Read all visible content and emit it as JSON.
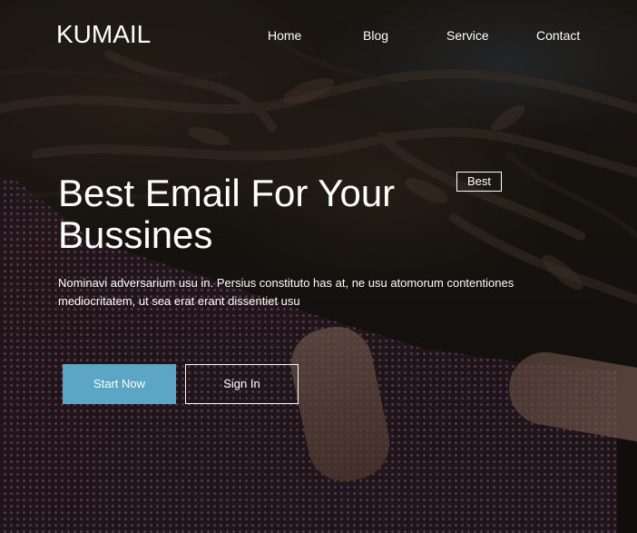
{
  "brand": {
    "logo_text": "KUMAIL"
  },
  "nav": {
    "items": [
      {
        "label": "Home"
      },
      {
        "label": "Blog"
      },
      {
        "label": "Service"
      },
      {
        "label": "Contact"
      }
    ]
  },
  "hero": {
    "badge": "Best",
    "headline": "Best Email For Your Bussines",
    "description": "Nominavi adversarium usu in. Persius constituto has at, ne usu atomorum contentiones mediocritatem, ut sea erat erant dissentiet usu",
    "primary_button": "Start Now",
    "secondary_button": "Sign In"
  },
  "colors": {
    "accent": "#5aa6c4",
    "text": "#ffffff"
  }
}
